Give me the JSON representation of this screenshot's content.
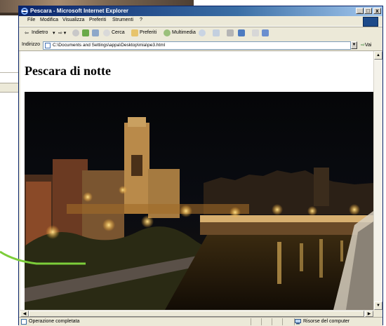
{
  "window": {
    "title": "Pescara - Microsoft Internet Explorer",
    "controls": {
      "minimize": "_",
      "maximize": "□",
      "close": "x"
    }
  },
  "menu": [
    "File",
    "Modifica",
    "Visualizza",
    "Preferiti",
    "Strumenti",
    "?"
  ],
  "toolbar": {
    "back": "Indietro",
    "search": "Cerca",
    "favorites": "Preferiti",
    "media": "Multimedia"
  },
  "address": {
    "label": "Indirizzo",
    "url": "C:\\Documents and Settings\\appa\\Desktop\\mia\\pe3.html",
    "go": "Vai"
  },
  "page": {
    "heading": "Pescara di notte"
  },
  "status": {
    "text": "Operazione completata",
    "zone": "Risorse del computer"
  },
  "colors": {
    "titlebar": "#0a246a",
    "annotation_line": "#7ccd3a",
    "chrome": "#ece9d8"
  }
}
